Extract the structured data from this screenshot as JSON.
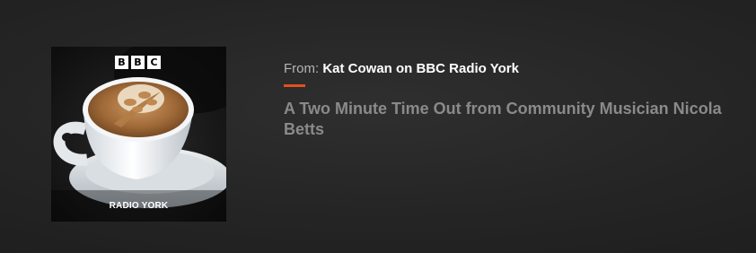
{
  "artwork": {
    "brand": [
      "B",
      "B",
      "C"
    ],
    "station": "RADIO YORK"
  },
  "info": {
    "from_prefix": "From:",
    "from_name": "Kat Cowan on BBC Radio York",
    "title": "A Two Minute Time Out from Community Musician Nicola Betts"
  },
  "colors": {
    "accent": "#e2501d",
    "background": "#252525",
    "title_text": "#8a8a8a"
  },
  "icons": [
    "bbc-logo",
    "coffee-cup-image"
  ]
}
